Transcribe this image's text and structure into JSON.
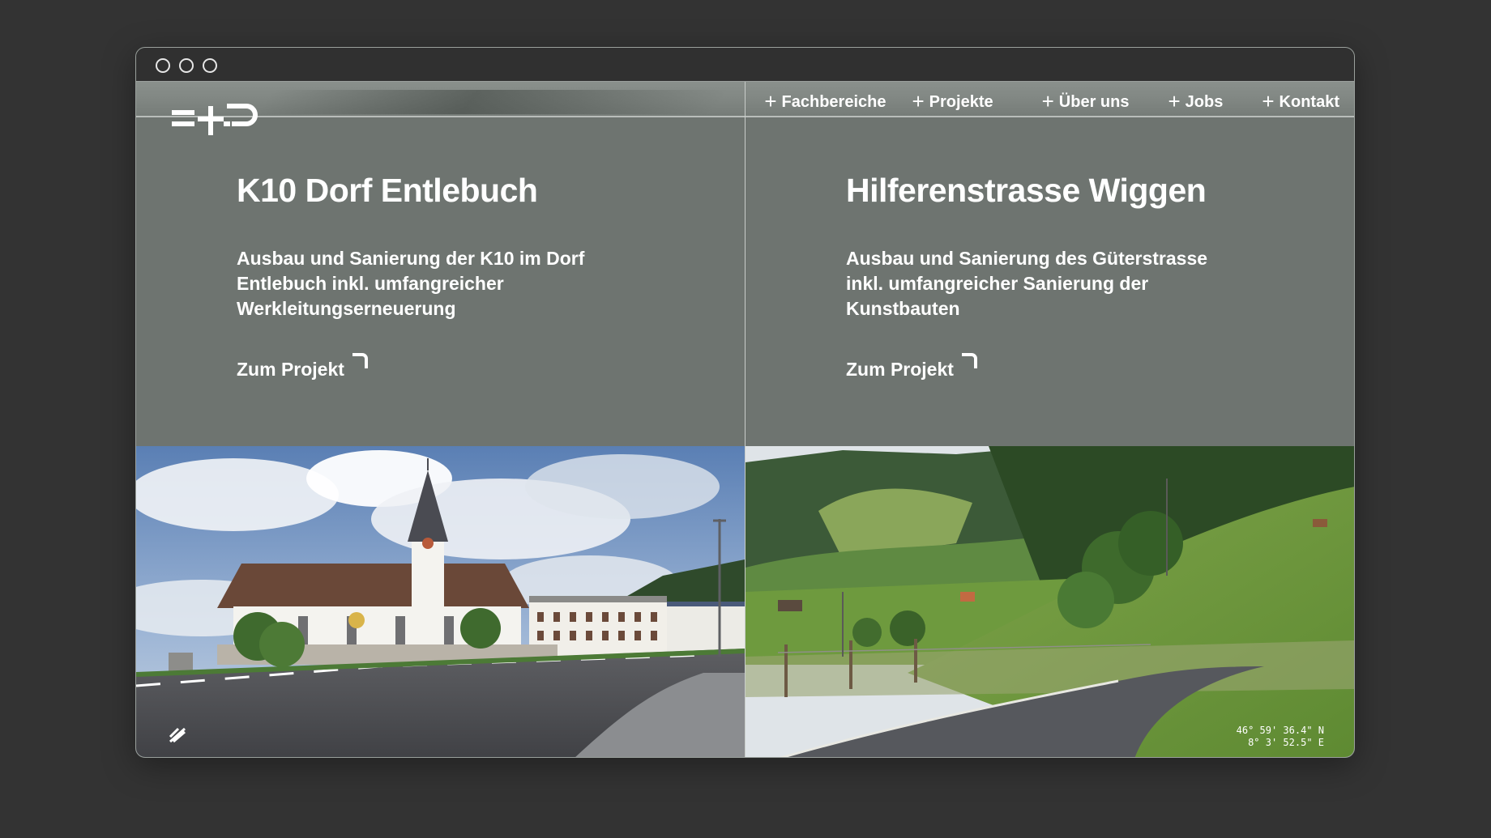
{
  "window": {
    "controls": [
      "circle-icon",
      "circle-icon",
      "circle-icon"
    ]
  },
  "brand": {
    "logo_icon": "logo-icon"
  },
  "nav": {
    "items": [
      {
        "label": "Fachbereiche",
        "icon": "plus-icon"
      },
      {
        "label": "Projekte",
        "icon": "plus-icon"
      },
      {
        "label": "Über uns",
        "icon": "plus-icon"
      },
      {
        "label": "Jobs",
        "icon": "plus-icon"
      },
      {
        "label": "Kontakt",
        "icon": "plus-icon"
      }
    ]
  },
  "projects": [
    {
      "title": "K10 Dorf Entlebuch",
      "description": "Ausbau und Sanierung der K10 im Dorf Entlebuch inkl. umfangreicher Werkleitungserneuerung",
      "cta": "Zum Projekt",
      "cta_icon": "corner-arrow-icon",
      "image": "church-street-photo"
    },
    {
      "title": "Hilferenstrasse Wiggen",
      "description": "Ausbau und Sanierung des Güterstrasse inkl. umfangreicher Sanierung der Kunstbauten",
      "cta": "Zum Projekt",
      "cta_icon": "corner-arrow-icon",
      "image": "hillside-road-photo",
      "coordinates": {
        "lat": "46° 59' 36.4\" N",
        "lon": "8° 3' 52.5\" E"
      }
    }
  ],
  "colors": {
    "panel": "#6e7470",
    "background": "#333333",
    "text": "#ffffff"
  }
}
